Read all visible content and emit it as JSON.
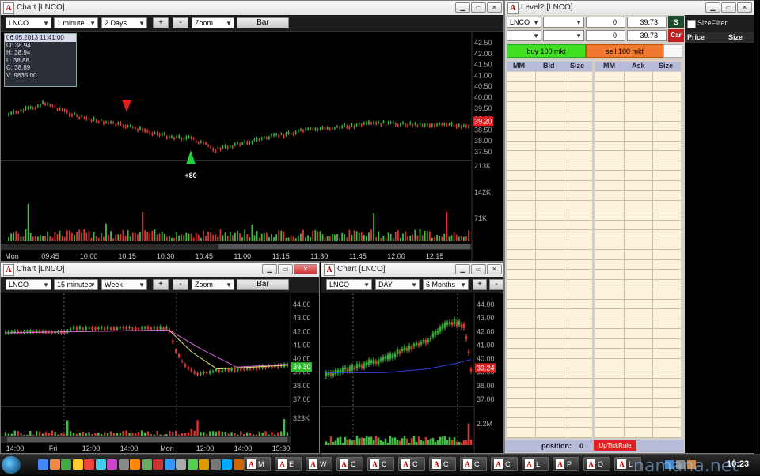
{
  "charts": {
    "top": {
      "title": "Chart [LNCO]",
      "symbol": "LNCO",
      "interval": "1 minute",
      "range": "2 Days",
      "zoom": "Zoom",
      "bar": "Bar",
      "plus": "+",
      "minus": "-",
      "info": {
        "date": "06.05.2013 11:41:00",
        "o": "O: 38.94",
        "h": "H: 38.94",
        "l": "L: 38.88",
        "c": "C: 38.89",
        "v": "V: 9835.00"
      },
      "yticks": [
        "42.50",
        "42.00",
        "41.50",
        "41.00",
        "40.50",
        "40.00",
        "39.50",
        "39.00",
        "38.50",
        "38.00",
        "37.50"
      ],
      "vticks": [
        "213K",
        "142K",
        "71K"
      ],
      "xticks": [
        "Mon",
        "09:45",
        "10:00",
        "10:15",
        "10:30",
        "10:45",
        "11:00",
        "11:15",
        "11:30",
        "11:45",
        "12:00",
        "12:15"
      ],
      "price_tag": "39.20",
      "annotation": "+80"
    },
    "bottom_left": {
      "title": "Chart [LNCO]",
      "symbol": "LNCO",
      "interval": "15 minutes",
      "range": "Week",
      "zoom": "Zoom",
      "bar": "Bar",
      "plus": "+",
      "minus": "-",
      "yticks": [
        "44.00",
        "43.00",
        "42.00",
        "41.00",
        "40.00",
        "39.00",
        "38.00",
        "37.00"
      ],
      "vticks": [
        "323K"
      ],
      "xticks": [
        "14:00",
        "Fri",
        "12:00",
        "14:00",
        "Mon",
        "12:00",
        "14:00",
        "15:30"
      ],
      "price_tag": "39.30"
    },
    "bottom_right": {
      "title": "Chart [LNCO]",
      "symbol": "LNCO",
      "interval": "DAY",
      "range": "6 Months",
      "plus": "+",
      "minus": "-",
      "yticks": [
        "44.00",
        "43.00",
        "42.00",
        "41.00",
        "40.00",
        "39.00",
        "38.00",
        "37.00"
      ],
      "vticks": [
        "2.2M"
      ],
      "price_tag": "39.24"
    }
  },
  "level2": {
    "title": "Level2 [LNCO]",
    "symbol": "LNCO",
    "qty1": "0",
    "price1": "39.73",
    "qty2": "0",
    "price2": "39.73",
    "send": "S",
    "cancel": "Car",
    "buy_label": "buy 100 mkt",
    "sell_label": "sell 100 mkt",
    "bid_headers": [
      "MM",
      "Bid",
      "Size"
    ],
    "ask_headers": [
      "MM",
      "Ask",
      "Size"
    ],
    "position_label": "position:",
    "position_value": "0",
    "uptick": "UpTickRule",
    "sizefilter": "SizeFilter",
    "price_header": "Price",
    "size_header": "Size"
  },
  "taskbar": {
    "items": [
      "M",
      "E",
      "W",
      "C",
      "C",
      "C",
      "C",
      "C",
      "C",
      "L",
      "P",
      "O",
      "L"
    ],
    "clock": "10:23"
  },
  "watermark": "namana.net"
}
